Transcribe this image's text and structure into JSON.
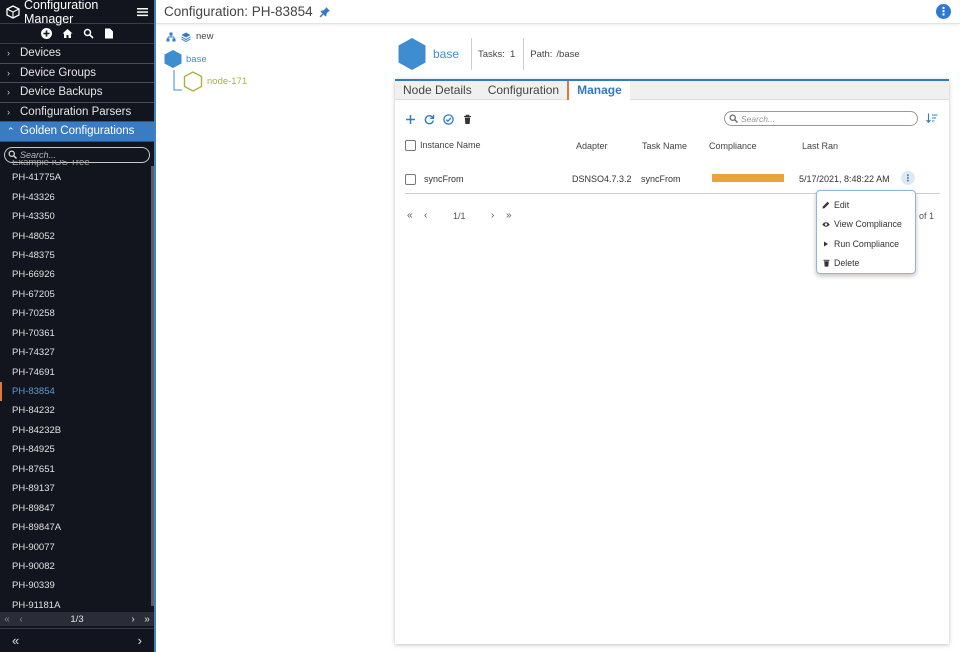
{
  "app": {
    "title": "Configuration Manager"
  },
  "sidebar": {
    "sections": [
      {
        "label": "Devices",
        "active": false
      },
      {
        "label": "Device Groups",
        "active": false
      },
      {
        "label": "Device Backups",
        "active": false
      },
      {
        "label": "Configuration Parsers",
        "active": false
      },
      {
        "label": "Golden Configurations",
        "active": true
      }
    ],
    "search_placeholder": "Search...",
    "cut_item": "Example IOS Tree",
    "items": [
      "PH-41775A",
      "PH-43326",
      "PH-43350",
      "PH-48052",
      "PH-48375",
      "PH-66926",
      "PH-67205",
      "PH-70258",
      "PH-70361",
      "PH-74327",
      "PH-74691",
      "PH-83854",
      "PH-84232",
      "PH-84232B",
      "PH-84925",
      "PH-87651",
      "PH-89137",
      "PH-89847",
      "PH-89847A",
      "PH-90077",
      "PH-90082",
      "PH-90339",
      "PH-91181A"
    ],
    "selected_item": "PH-83854",
    "pager": {
      "first": "«",
      "prev": "‹",
      "page": "1/3",
      "next": "›",
      "last": "»"
    },
    "bottom": {
      "collapse": "«",
      "expand": "›"
    }
  },
  "header": {
    "title": "Configuration: PH-83854"
  },
  "tree": {
    "new_label": "new",
    "nodes": [
      {
        "label": "base"
      },
      {
        "label": "node-171"
      }
    ]
  },
  "node_header": {
    "name": "base",
    "tasks_label": "Tasks:",
    "tasks_value": "1",
    "path_label": "Path:",
    "path_value": "/base"
  },
  "tabs": [
    {
      "label": "Node Details",
      "active": false
    },
    {
      "label": "Configuration",
      "active": false
    },
    {
      "label": "Manage",
      "active": true
    }
  ],
  "manage": {
    "search_placeholder": "Search...",
    "columns": {
      "instance": "Instance Name",
      "adapter": "Adapter",
      "task": "Task Name",
      "compliance": "Compliance",
      "last_ran": "Last Ran"
    },
    "rows": [
      {
        "instance": "syncFrom",
        "adapter": "DSNSO4.7.3.2",
        "task": "syncFrom",
        "compliance": 1.0,
        "compliance_color": "#eaa23c",
        "last_ran": "5/17/2021, 8:48:22 AM"
      }
    ],
    "pager": {
      "first": "«",
      "prev": "‹",
      "page": "1/1",
      "next": "›",
      "last": "»",
      "of": "of 1"
    },
    "row_menu": [
      {
        "label": "Edit",
        "icon": "pencil-icon"
      },
      {
        "label": "View Compliance",
        "icon": "eye-icon"
      },
      {
        "label": "Run Compliance",
        "icon": "play-icon"
      },
      {
        "label": "Delete",
        "icon": "trash-icon"
      }
    ]
  },
  "colors": {
    "accent": "#2f7bc7",
    "sidebar_bg": "#13151e",
    "active_section": "#3a7cc4",
    "selected_marker": "#e0763a",
    "tree_child": "#a6b43a"
  }
}
